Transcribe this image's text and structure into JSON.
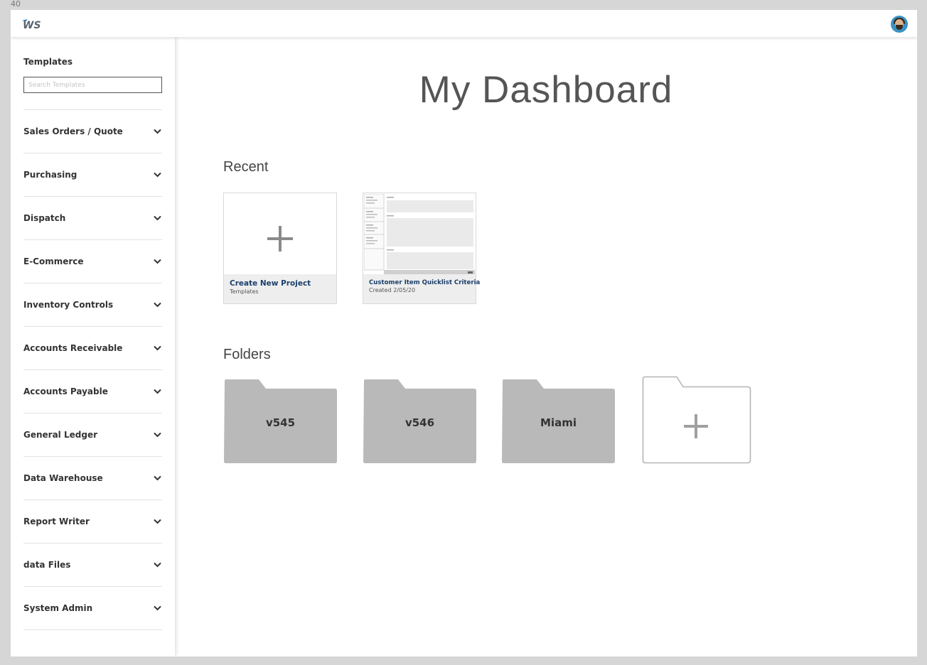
{
  "page_number": "40",
  "header": {
    "logo_text": "WS",
    "avatar_icon": "user-avatar-icon"
  },
  "sidebar": {
    "title": "Templates",
    "search_placeholder": "Search Templates",
    "items": [
      {
        "label": "Sales Orders / Quote"
      },
      {
        "label": "Purchasing"
      },
      {
        "label": "Dispatch"
      },
      {
        "label": "E-Commerce"
      },
      {
        "label": "Inventory Controls"
      },
      {
        "label": "Accounts Receivable"
      },
      {
        "label": "Accounts Payable"
      },
      {
        "label": "General Ledger"
      },
      {
        "label": "Data Warehouse"
      },
      {
        "label": "Report Writer"
      },
      {
        "label": "data Files"
      },
      {
        "label": "System Admin"
      }
    ]
  },
  "main": {
    "title": "My Dashboard",
    "recent_heading": "Recent",
    "recent": [
      {
        "name": "Create New Project",
        "sub": "Templates"
      },
      {
        "name": "Customer Item Quicklist Criteria",
        "sub": "Created 2/05/20"
      }
    ],
    "folders_heading": "Folders",
    "folders": [
      {
        "name": "v545"
      },
      {
        "name": "v546"
      },
      {
        "name": "Miami"
      }
    ]
  },
  "colors": {
    "accent": "#1b3f6b",
    "logo_blue": "#2e79b9",
    "folder_fill": "#b9b9b9",
    "avatar_bg": "#3b92c4"
  }
}
